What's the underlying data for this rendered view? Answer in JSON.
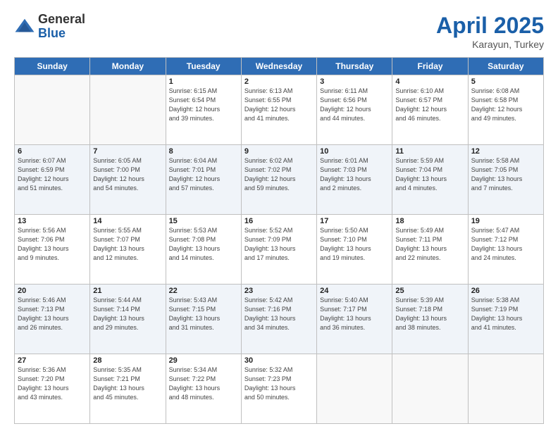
{
  "header": {
    "logo_general": "General",
    "logo_blue": "Blue",
    "month": "April 2025",
    "location": "Karayun, Turkey"
  },
  "days_of_week": [
    "Sunday",
    "Monday",
    "Tuesday",
    "Wednesday",
    "Thursday",
    "Friday",
    "Saturday"
  ],
  "weeks": [
    [
      {
        "day": "",
        "info": ""
      },
      {
        "day": "",
        "info": ""
      },
      {
        "day": "1",
        "info": "Sunrise: 6:15 AM\nSunset: 6:54 PM\nDaylight: 12 hours\nand 39 minutes."
      },
      {
        "day": "2",
        "info": "Sunrise: 6:13 AM\nSunset: 6:55 PM\nDaylight: 12 hours\nand 41 minutes."
      },
      {
        "day": "3",
        "info": "Sunrise: 6:11 AM\nSunset: 6:56 PM\nDaylight: 12 hours\nand 44 minutes."
      },
      {
        "day": "4",
        "info": "Sunrise: 6:10 AM\nSunset: 6:57 PM\nDaylight: 12 hours\nand 46 minutes."
      },
      {
        "day": "5",
        "info": "Sunrise: 6:08 AM\nSunset: 6:58 PM\nDaylight: 12 hours\nand 49 minutes."
      }
    ],
    [
      {
        "day": "6",
        "info": "Sunrise: 6:07 AM\nSunset: 6:59 PM\nDaylight: 12 hours\nand 51 minutes."
      },
      {
        "day": "7",
        "info": "Sunrise: 6:05 AM\nSunset: 7:00 PM\nDaylight: 12 hours\nand 54 minutes."
      },
      {
        "day": "8",
        "info": "Sunrise: 6:04 AM\nSunset: 7:01 PM\nDaylight: 12 hours\nand 57 minutes."
      },
      {
        "day": "9",
        "info": "Sunrise: 6:02 AM\nSunset: 7:02 PM\nDaylight: 12 hours\nand 59 minutes."
      },
      {
        "day": "10",
        "info": "Sunrise: 6:01 AM\nSunset: 7:03 PM\nDaylight: 13 hours\nand 2 minutes."
      },
      {
        "day": "11",
        "info": "Sunrise: 5:59 AM\nSunset: 7:04 PM\nDaylight: 13 hours\nand 4 minutes."
      },
      {
        "day": "12",
        "info": "Sunrise: 5:58 AM\nSunset: 7:05 PM\nDaylight: 13 hours\nand 7 minutes."
      }
    ],
    [
      {
        "day": "13",
        "info": "Sunrise: 5:56 AM\nSunset: 7:06 PM\nDaylight: 13 hours\nand 9 minutes."
      },
      {
        "day": "14",
        "info": "Sunrise: 5:55 AM\nSunset: 7:07 PM\nDaylight: 13 hours\nand 12 minutes."
      },
      {
        "day": "15",
        "info": "Sunrise: 5:53 AM\nSunset: 7:08 PM\nDaylight: 13 hours\nand 14 minutes."
      },
      {
        "day": "16",
        "info": "Sunrise: 5:52 AM\nSunset: 7:09 PM\nDaylight: 13 hours\nand 17 minutes."
      },
      {
        "day": "17",
        "info": "Sunrise: 5:50 AM\nSunset: 7:10 PM\nDaylight: 13 hours\nand 19 minutes."
      },
      {
        "day": "18",
        "info": "Sunrise: 5:49 AM\nSunset: 7:11 PM\nDaylight: 13 hours\nand 22 minutes."
      },
      {
        "day": "19",
        "info": "Sunrise: 5:47 AM\nSunset: 7:12 PM\nDaylight: 13 hours\nand 24 minutes."
      }
    ],
    [
      {
        "day": "20",
        "info": "Sunrise: 5:46 AM\nSunset: 7:13 PM\nDaylight: 13 hours\nand 26 minutes."
      },
      {
        "day": "21",
        "info": "Sunrise: 5:44 AM\nSunset: 7:14 PM\nDaylight: 13 hours\nand 29 minutes."
      },
      {
        "day": "22",
        "info": "Sunrise: 5:43 AM\nSunset: 7:15 PM\nDaylight: 13 hours\nand 31 minutes."
      },
      {
        "day": "23",
        "info": "Sunrise: 5:42 AM\nSunset: 7:16 PM\nDaylight: 13 hours\nand 34 minutes."
      },
      {
        "day": "24",
        "info": "Sunrise: 5:40 AM\nSunset: 7:17 PM\nDaylight: 13 hours\nand 36 minutes."
      },
      {
        "day": "25",
        "info": "Sunrise: 5:39 AM\nSunset: 7:18 PM\nDaylight: 13 hours\nand 38 minutes."
      },
      {
        "day": "26",
        "info": "Sunrise: 5:38 AM\nSunset: 7:19 PM\nDaylight: 13 hours\nand 41 minutes."
      }
    ],
    [
      {
        "day": "27",
        "info": "Sunrise: 5:36 AM\nSunset: 7:20 PM\nDaylight: 13 hours\nand 43 minutes."
      },
      {
        "day": "28",
        "info": "Sunrise: 5:35 AM\nSunset: 7:21 PM\nDaylight: 13 hours\nand 45 minutes."
      },
      {
        "day": "29",
        "info": "Sunrise: 5:34 AM\nSunset: 7:22 PM\nDaylight: 13 hours\nand 48 minutes."
      },
      {
        "day": "30",
        "info": "Sunrise: 5:32 AM\nSunset: 7:23 PM\nDaylight: 13 hours\nand 50 minutes."
      },
      {
        "day": "",
        "info": ""
      },
      {
        "day": "",
        "info": ""
      },
      {
        "day": "",
        "info": ""
      }
    ]
  ]
}
